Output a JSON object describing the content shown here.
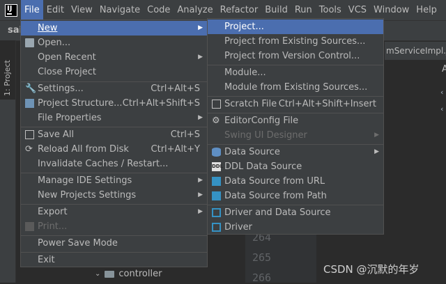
{
  "menubar": {
    "items": [
      "File",
      "Edit",
      "View",
      "Navigate",
      "Code",
      "Analyze",
      "Refactor",
      "Build",
      "Run",
      "Tools",
      "VCS",
      "Window",
      "Help"
    ],
    "active": "File"
  },
  "project_name": "sai",
  "project_tab": "1: Project",
  "editor_tab": "mServiceImpl.ja",
  "editor_letter": "A",
  "line_numbers": [
    "264",
    "265",
    "266"
  ],
  "tree_item": "controller",
  "watermark": "CSDN @沉默的年岁",
  "file_menu": {
    "new": "New",
    "open": "Open...",
    "open_recent": "Open Recent",
    "close_project": "Close Project",
    "settings": "Settings...",
    "settings_sc": "Ctrl+Alt+S",
    "project_structure": "Project Structure...",
    "project_structure_sc": "Ctrl+Alt+Shift+S",
    "file_properties": "File Properties",
    "save_all": "Save All",
    "save_all_sc": "Ctrl+S",
    "reload": "Reload All from Disk",
    "reload_sc": "Ctrl+Alt+Y",
    "invalidate": "Invalidate Caches / Restart...",
    "manage_ide": "Manage IDE Settings",
    "new_projects_settings": "New Projects Settings",
    "export": "Export",
    "print": "Print...",
    "power_save": "Power Save Mode",
    "exit": "Exit"
  },
  "new_menu": {
    "project": "Project...",
    "from_existing": "Project from Existing Sources...",
    "from_vcs": "Project from Version Control...",
    "module": "Module...",
    "module_existing": "Module from Existing Sources...",
    "scratch": "Scratch File",
    "scratch_sc": "Ctrl+Alt+Shift+Insert",
    "editorconfig": "EditorConfig File",
    "swing": "Swing UI Designer",
    "data_source": "Data Source",
    "ddl": "DDL Data Source",
    "ds_url": "Data Source from URL",
    "ds_path": "Data Source from Path",
    "driver_ds": "Driver and Data Source",
    "driver": "Driver"
  },
  "colors": {
    "selection": "#4b6eaf",
    "menu_bg": "#3c3f41",
    "editor_bg": "#2b2b2b"
  }
}
